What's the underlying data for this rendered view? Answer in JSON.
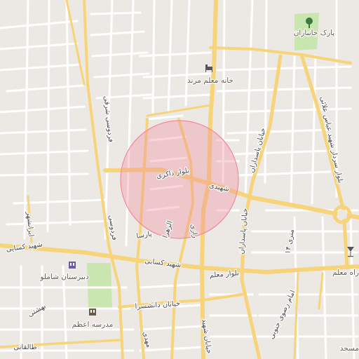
{
  "map": {
    "highlight_color": "#f08a9c",
    "road_color": "#f7d37a",
    "street_color": "#ffffff",
    "park_color": "#c9e6b0",
    "background_color": "#ece9e4"
  },
  "pois": {
    "park_janbazan": "پارک جانبازان",
    "teacher_house": "خانه معلم مرند",
    "shamlou_school": "دبیرستان شاملو",
    "azam_school": "مدرسه اعظم",
    "moallem_way": "راه معلم",
    "masjed": "مسجد"
  },
  "roads": {
    "zakeri_blvd": "بلوار ذاکری",
    "shohada_st": "شهیدی",
    "kasaei_west": "شهید کسایی",
    "kasaei_east": "شهید کسایی",
    "moallem_blvd": "بلوار معلم",
    "daneshsara_st": "خیابان دانشسرا",
    "pasdaran_1": "خیابان پاسداران",
    "pasdaran_2": "خیابان پاسداران",
    "ferdowsi_north": "فردوسی شرقی",
    "ferdowsi_2": "فردوسی",
    "taleghani": "طالقانی",
    "abbasi_blvd": "بلوار سردار شهید عباس علائی",
    "parsa": "پارسا",
    "razi": "رازی",
    "azhar": "الزهرا",
    "moallem_14": "۱۴ متری",
    "razavi_south": "امام رضوی جنوبی",
    "beheshti": "بهشتی",
    "iranshahr": "ایرانشهر",
    "mahdi": "مهدی",
    "chat_shahid": "خیابان شهید"
  },
  "icons": {
    "park": "tree-icon",
    "hotel": "bed-icon",
    "school": "school-icon",
    "drink": "cocktail-icon"
  }
}
